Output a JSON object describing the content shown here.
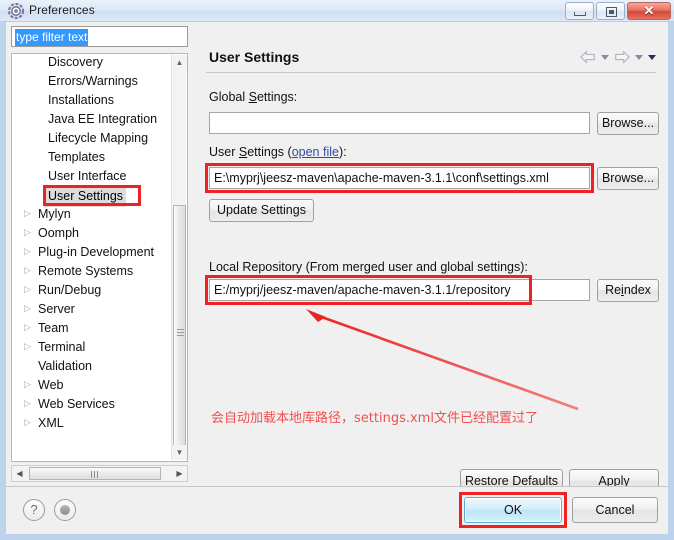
{
  "window": {
    "title": "Preferences",
    "icon": "preferences-gear-icon",
    "minimize_label": "Minimize",
    "maximize_label": "Maximize",
    "close_label": "Close"
  },
  "sidebar": {
    "filter": {
      "value": "type filter text",
      "placeholder": "type filter text",
      "selected": true
    },
    "items": [
      {
        "label": "Discovery",
        "level": "child",
        "expandable": false,
        "selected": false
      },
      {
        "label": "Errors/Warnings",
        "level": "child",
        "expandable": false,
        "selected": false
      },
      {
        "label": "Installations",
        "level": "child",
        "expandable": false,
        "selected": false
      },
      {
        "label": "Java EE Integration",
        "level": "child",
        "expandable": false,
        "selected": false
      },
      {
        "label": "Lifecycle Mapping",
        "level": "child",
        "expandable": false,
        "selected": false
      },
      {
        "label": "Templates",
        "level": "child",
        "expandable": false,
        "selected": false
      },
      {
        "label": "User Interface",
        "level": "child",
        "expandable": false,
        "selected": false
      },
      {
        "label": "User Settings",
        "level": "child",
        "expandable": false,
        "selected": true
      },
      {
        "label": "Mylyn",
        "level": "parent",
        "expandable": true,
        "selected": false
      },
      {
        "label": "Oomph",
        "level": "parent",
        "expandable": true,
        "selected": false
      },
      {
        "label": "Plug-in Development",
        "level": "parent",
        "expandable": true,
        "selected": false
      },
      {
        "label": "Remote Systems",
        "level": "parent",
        "expandable": true,
        "selected": false
      },
      {
        "label": "Run/Debug",
        "level": "parent",
        "expandable": true,
        "selected": false
      },
      {
        "label": "Server",
        "level": "parent",
        "expandable": true,
        "selected": false
      },
      {
        "label": "Team",
        "level": "parent",
        "expandable": true,
        "selected": false
      },
      {
        "label": "Terminal",
        "level": "parent",
        "expandable": true,
        "selected": false
      },
      {
        "label": "Validation",
        "level": "parent",
        "expandable": false,
        "selected": false
      },
      {
        "label": "Web",
        "level": "parent",
        "expandable": true,
        "selected": false
      },
      {
        "label": "Web Services",
        "level": "parent",
        "expandable": true,
        "selected": false
      },
      {
        "label": "XML",
        "level": "parent",
        "expandable": true,
        "selected": false
      }
    ],
    "twisty_glyph": "▷"
  },
  "main": {
    "title": "User Settings",
    "nav": {
      "back_icon": "back-arrow-icon",
      "back_menu_icon": "chevron-down-icon",
      "forward_icon": "forward-arrow-icon",
      "forward_menu_icon": "chevron-down-icon",
      "view_menu_icon": "chevron-down-filled-icon"
    },
    "global_settings": {
      "label_prefix": "Global ",
      "label_underlined": "S",
      "label_suffix": "ettings:",
      "value": "",
      "browse_label": "Browse..."
    },
    "user_settings": {
      "label_prefix": "User ",
      "label_underlined": "S",
      "label_mid": "ettings (",
      "link_label": "open file",
      "label_suffix": "):",
      "value": "E:\\myprj\\jeesz-maven\\apache-maven-3.1.1\\conf\\settings.xml",
      "browse_label": "Browse...",
      "update_label": "Update Settings",
      "highlighted": true
    },
    "local_repository": {
      "label": "Local Repository (From merged user and global settings):",
      "value": "E:/myprj/jeesz-maven/apache-maven-3.1.1/repository",
      "reindex_prefix": "Re",
      "reindex_underlined": "i",
      "reindex_suffix": "ndex",
      "highlighted": true
    },
    "annotation": {
      "text": "会自动加载本地库路径，settings.xml文件已经配置过了",
      "color": "#f05050",
      "arrow_icon": "red-arrow-icon"
    },
    "restore_defaults": {
      "prefix": "Restore ",
      "underlined": "D",
      "suffix": "efaults"
    },
    "apply": {
      "prefix": "",
      "underlined": "A",
      "suffix": "pply"
    }
  },
  "footer": {
    "help_icon": "question-mark-icon",
    "extra_icon": "circle-button-icon",
    "ok_label": "OK",
    "cancel_label": "Cancel",
    "ok_highlighted": true
  },
  "colors": {
    "annotation_red": "#ee2222",
    "annotation_text": "#f05050",
    "link_blue": "#2b4ea2",
    "selection_blue": "#3399ff",
    "ok_border": "#5aaed6"
  }
}
